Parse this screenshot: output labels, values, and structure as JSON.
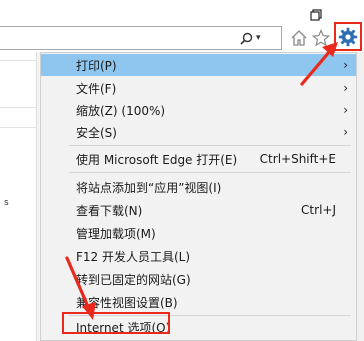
{
  "window": {
    "restore_icon": "restore-window-icon"
  },
  "toolbar": {
    "search_icon": "search-icon",
    "search_dropdown": "▾",
    "home_icon": "home-icon",
    "favorites_icon": "star-icon",
    "tools_icon": "gear-icon"
  },
  "page": {
    "stub_text": "s"
  },
  "menu": {
    "items": [
      {
        "label": "打印(P)",
        "shortcut": "",
        "submenu": true
      },
      {
        "label": "文件(F)",
        "shortcut": "",
        "submenu": true
      },
      {
        "label": "缩放(Z) (100%)",
        "shortcut": "",
        "submenu": true
      },
      {
        "label": "安全(S)",
        "shortcut": "",
        "submenu": true
      },
      {
        "label": "使用 Microsoft Edge 打开(E)",
        "shortcut": "Ctrl+Shift+E",
        "submenu": false
      },
      {
        "label": "将站点添加到“应用”视图(I)",
        "shortcut": "",
        "submenu": false
      },
      {
        "label": "查看下载(N)",
        "shortcut": "Ctrl+J",
        "submenu": false
      },
      {
        "label": "管理加载项(M)",
        "shortcut": "",
        "submenu": false
      },
      {
        "label": "F12 开发人员工具(L)",
        "shortcut": "",
        "submenu": false
      },
      {
        "label": "转到已固定的网站(G)",
        "shortcut": "",
        "submenu": false
      },
      {
        "label": "兼容性视图设置(B)",
        "shortcut": "",
        "submenu": false
      },
      {
        "label": "Internet 选项(O)",
        "shortcut": "",
        "submenu": false
      }
    ],
    "submenu_arrow": "›"
  },
  "colors": {
    "highlight": "#8fc6ef",
    "annotation": "#e8291c"
  }
}
